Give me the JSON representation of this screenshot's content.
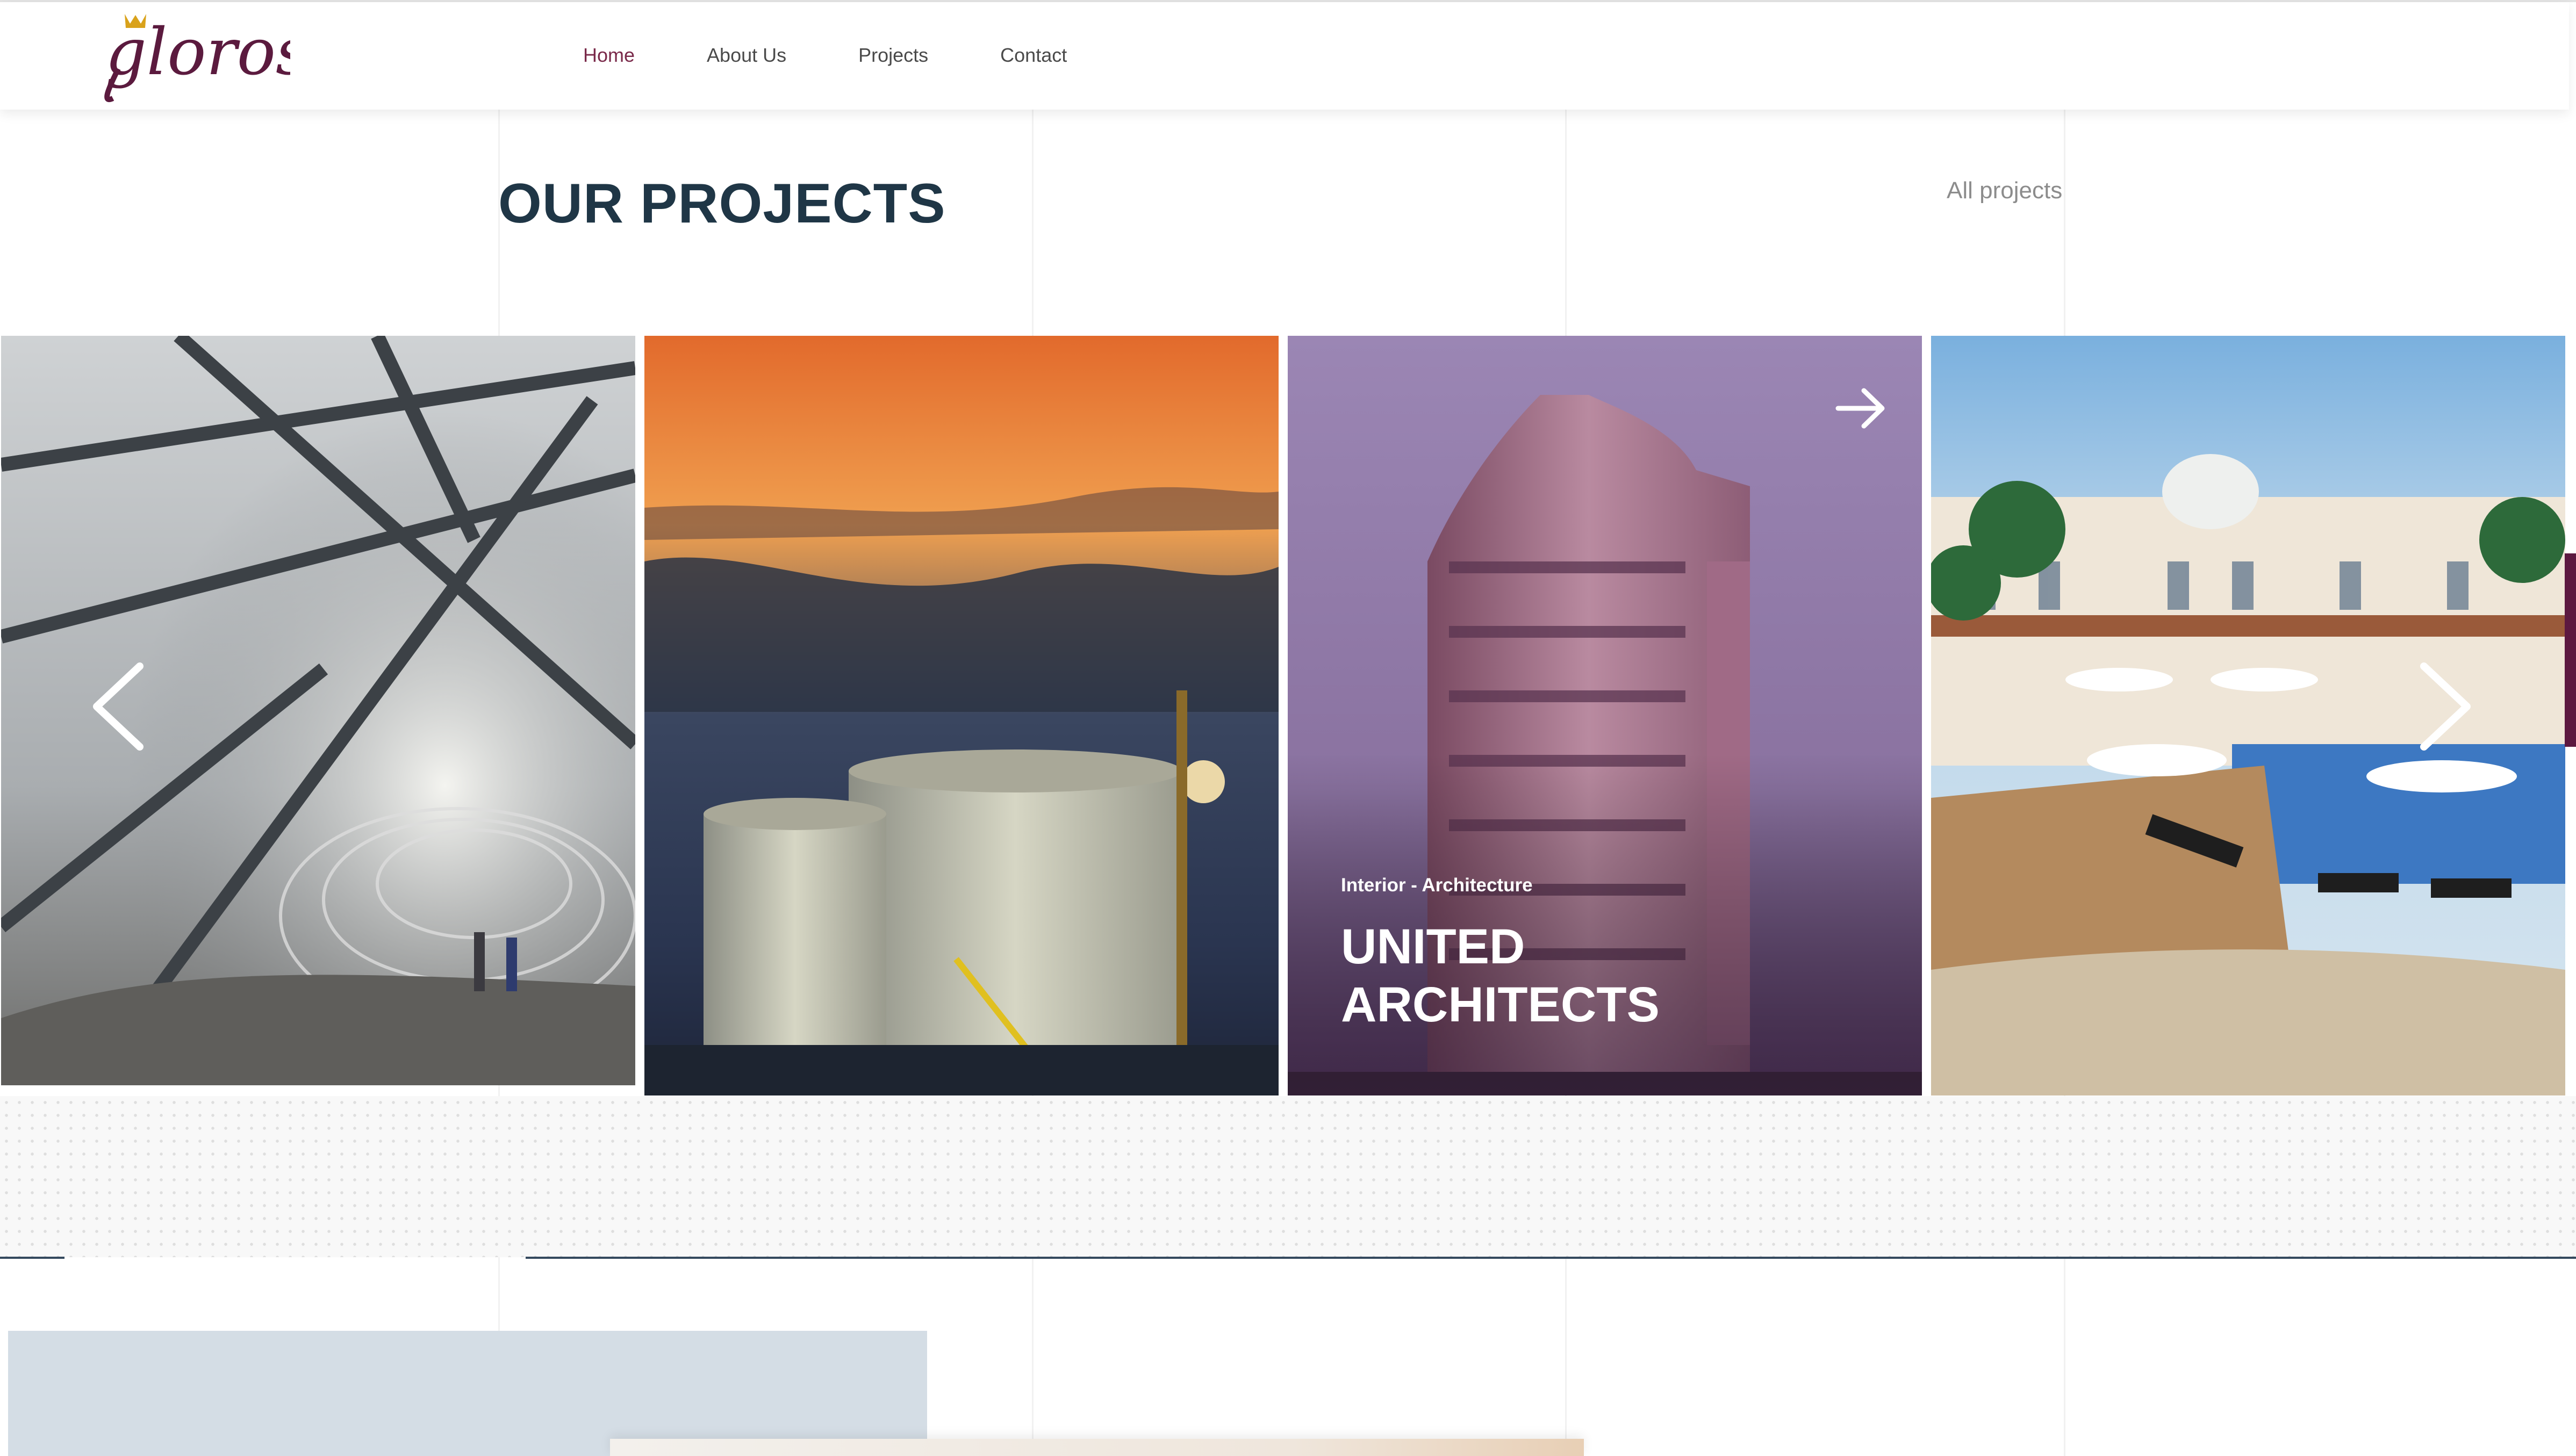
{
  "brand": {
    "logo_text": "gloros"
  },
  "nav": {
    "items": [
      {
        "label": "Home",
        "active": true
      },
      {
        "label": "About Us",
        "active": false
      },
      {
        "label": "Projects",
        "active": false
      },
      {
        "label": "Contact",
        "active": false
      }
    ]
  },
  "projects": {
    "heading": "OUR PROJECTS",
    "all_link": "All projects",
    "featured": {
      "category": "Interior - Architecture",
      "title": "UNITED\nARCHITECTS"
    },
    "cards": [
      {
        "image": "steel-canopy-walkway"
      },
      {
        "image": "storage-tanks-at-sunset"
      },
      {
        "image": "high-rise-building"
      },
      {
        "image": "resort-pool-terrace"
      }
    ]
  },
  "colors": {
    "accent": "#7a2a4a",
    "heading": "#1f3646",
    "divider": "#34495e",
    "side_accent": "#5c1840"
  }
}
